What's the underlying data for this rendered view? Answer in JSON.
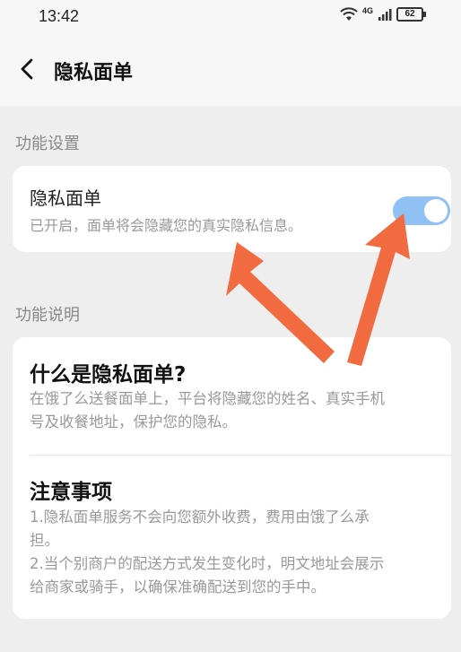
{
  "status_bar": {
    "time": "13:42",
    "network": "4G",
    "battery": "62"
  },
  "nav": {
    "title": "隐私面单"
  },
  "settings_section": {
    "label": "功能设置",
    "toggle_title": "隐私面单",
    "toggle_desc": "已开启，面单将会隐藏您的真实隐私信息。",
    "toggle_on": true,
    "accent": "#8fc1f4"
  },
  "info_section": {
    "label": "功能说明",
    "what_title": "什么是隐私面单?",
    "what_text_1": "在饿了么送餐面单上，平台将隐藏您的姓名、真实手机",
    "what_text_2": "号及收餐地址，保护您的隐私。",
    "notice_title": "注意事项",
    "notice_1a": "1.隐私面单服务不会向您额外收费，费用由饿了么承",
    "notice_1b": "担。",
    "notice_2a": "2.当个别商户的配送方式发生变化时，明文地址会展示",
    "notice_2b": "给商家或骑手，以确保准确配送到您的手中。"
  },
  "annotation": {
    "arrow_color": "#f26a3f"
  }
}
